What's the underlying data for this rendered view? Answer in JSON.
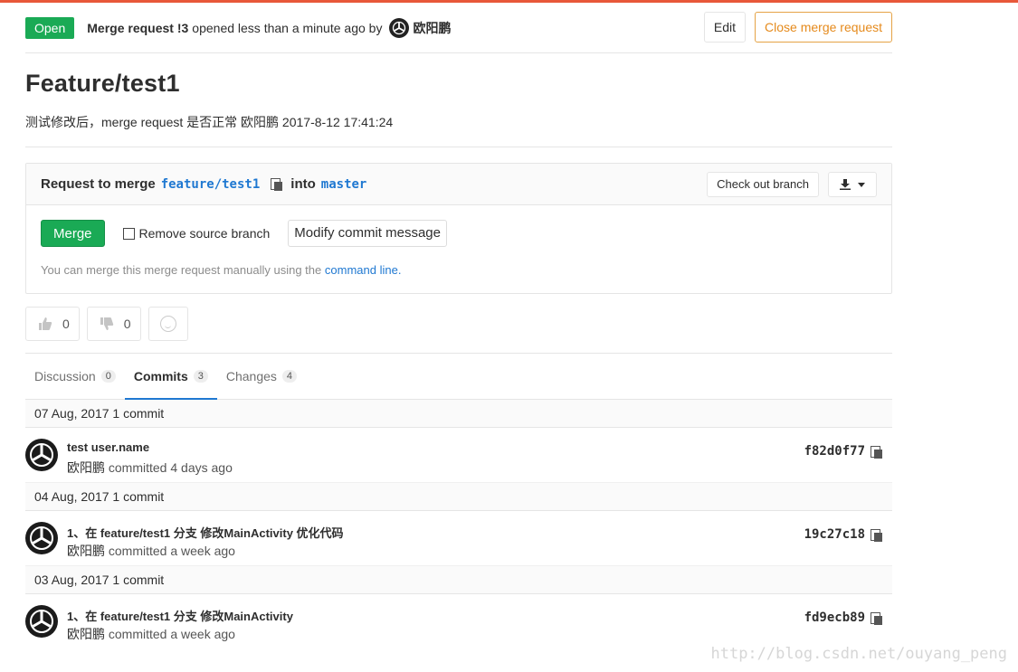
{
  "header": {
    "status": "Open",
    "mr_ref": "Merge request !3",
    "opened_text": "opened less than a minute ago by",
    "author": "欧阳鹏",
    "edit_label": "Edit",
    "close_label": "Close merge request"
  },
  "title": "Feature/test1",
  "description": "测试修改后，merge request 是否正常 欧阳鹏 2017-8-12 17:41:24",
  "merge_box": {
    "request_label": "Request to merge",
    "source_branch": "feature/test1",
    "into_label": "into",
    "target_branch": "master",
    "checkout_label": "Check out branch",
    "merge_label": "Merge",
    "remove_source_label": "Remove source branch",
    "modify_label": "Modify commit message",
    "hint_text": "You can merge this merge request manually using the",
    "hint_link": "command line."
  },
  "awards": {
    "thumbsup": "0",
    "thumbsdown": "0"
  },
  "tabs": [
    {
      "label": "Discussion",
      "count": "0"
    },
    {
      "label": "Commits",
      "count": "3"
    },
    {
      "label": "Changes",
      "count": "4"
    }
  ],
  "commit_groups": [
    {
      "day": "07 Aug, 2017 1 commit",
      "title": "test user.name",
      "author": "欧阳鹏",
      "meta": "committed 4 days ago",
      "sha": "f82d0f77"
    },
    {
      "day": "04 Aug, 2017 1 commit",
      "title": "1、在 feature/test1 分支 修改MainActivity 优化代码",
      "author": "欧阳鹏",
      "meta": "committed a week ago",
      "sha": "19c27c18"
    },
    {
      "day": "03 Aug, 2017 1 commit",
      "title": "1、在 feature/test1 分支 修改MainActivity",
      "author": "欧阳鹏",
      "meta": "committed a week ago",
      "sha": "fd9ecb89"
    }
  ],
  "watermark": "http://blog.csdn.net/ouyang_peng",
  "colors": {
    "accent": "#e8583a",
    "success": "#1aaa55",
    "link": "#1f78d1",
    "close": "#e58a1c"
  }
}
